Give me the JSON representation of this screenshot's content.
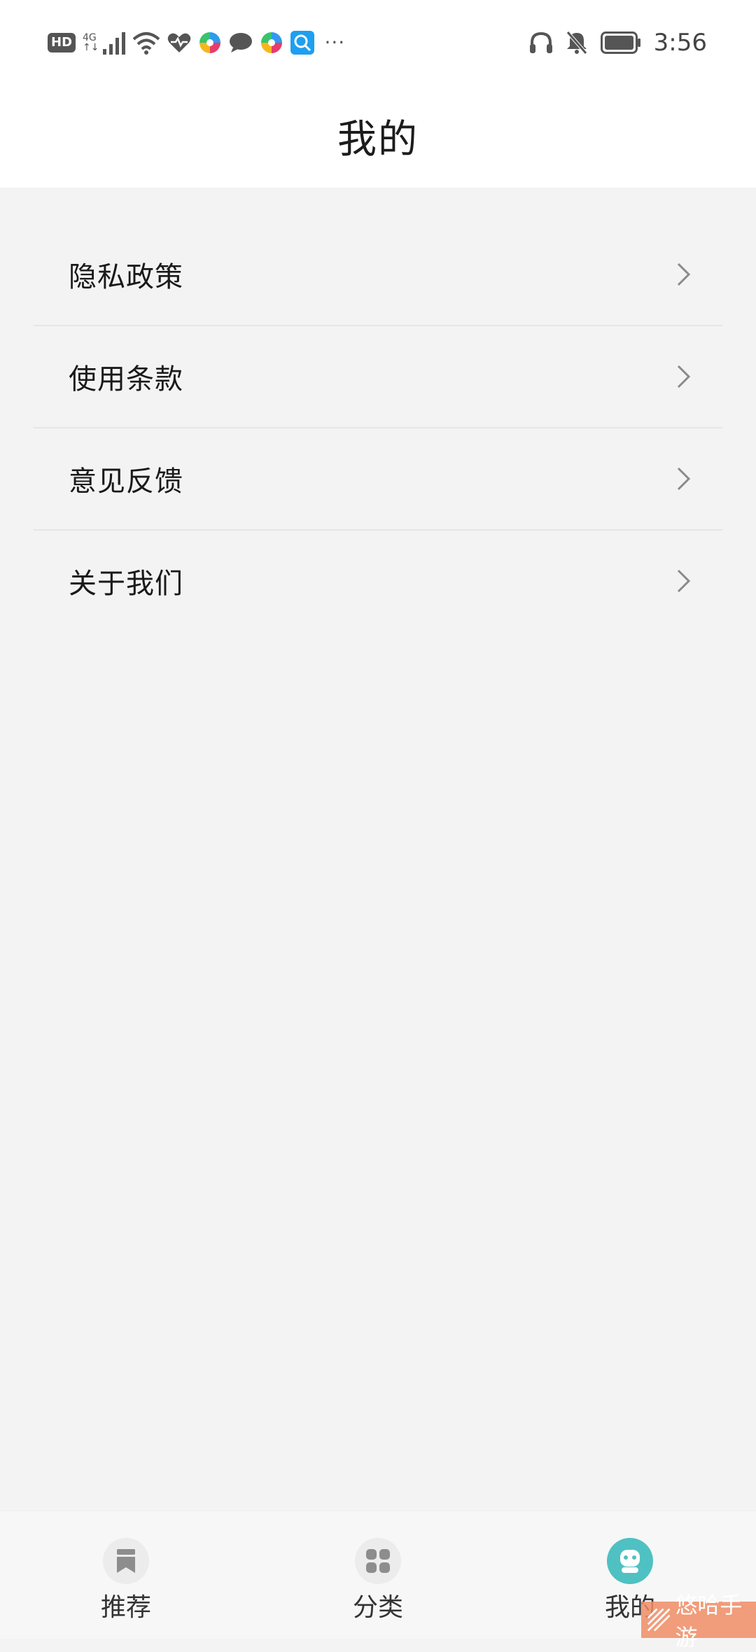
{
  "status_bar": {
    "hd": "HD",
    "net_top": "4G",
    "net_bottom": "↑↓",
    "more": "···",
    "time": "3:56"
  },
  "header": {
    "title": "我的"
  },
  "menu": {
    "items": [
      {
        "label": "隐私政策"
      },
      {
        "label": "使用条款"
      },
      {
        "label": "意见反馈"
      },
      {
        "label": "关于我们"
      }
    ]
  },
  "bottom_nav": {
    "items": [
      {
        "label": "推荐",
        "icon": "bookmark-icon",
        "active": false
      },
      {
        "label": "分类",
        "icon": "grid-icon",
        "active": false
      },
      {
        "label": "我的",
        "icon": "robot-icon",
        "active": true
      }
    ]
  },
  "watermark": {
    "text": "悠哈手游"
  },
  "colors": {
    "accent": "#4fc1c2",
    "background": "#f3f3f3",
    "header_bg": "#ffffff"
  }
}
